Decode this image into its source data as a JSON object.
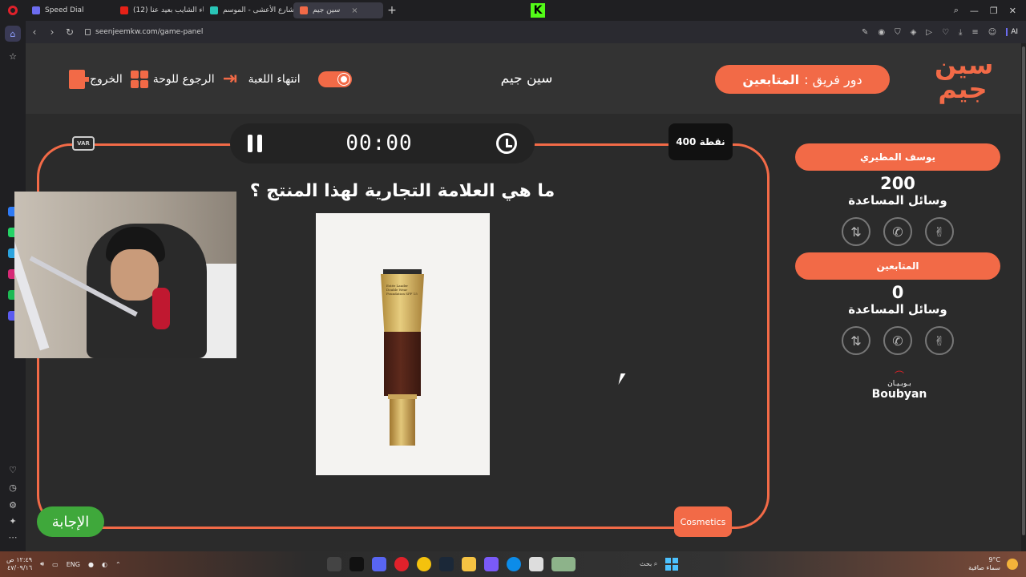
{
  "browser": {
    "tabs": [
      {
        "label": "Speed Dial",
        "fav_color": "#6c6cf0"
      },
      {
        "label": "(12) شيماء الشايب بعيد عنا...",
        "fav_color": "#e62117"
      },
      {
        "label": "شاهد شارع الأعشى - الموسم...",
        "fav_color": "#29c5b7"
      },
      {
        "label": "سين جيم",
        "fav_color": "#f26a47"
      }
    ],
    "new_tab": "+",
    "url": "seenjeemkw.com/game-panel",
    "ai_label": "AI"
  },
  "topbar": {
    "logo_text": "سين جيم",
    "turn_prefix": "دور فريق :",
    "turn_team": "المتابعين",
    "game_title": "سين جيم",
    "exit_label": "الخروج",
    "back_label": "الرجوع للوحة",
    "end_label": "انتهاء اللعبة"
  },
  "game": {
    "timer": "00:00",
    "points": "400 نقطة",
    "var_label": "VAR",
    "question": "ما هي العلامة التجارية لهذا المنتج ؟",
    "product_label": "Estée Lauder Double Wear Foundation SPF 15",
    "category": "Cosmetics",
    "answer_button": "الإجابة"
  },
  "teams": [
    {
      "name": "يوسف المطيري",
      "score": "200",
      "aids_label": "وسائل المساعدة",
      "aids": [
        "phone-swap-icon",
        "phone-icon",
        "peace-hand-icon"
      ]
    },
    {
      "name": "المتابعين",
      "score": "0",
      "aids_label": "وسائل المساعدة",
      "aids": [
        "phone-swap-icon",
        "phone-icon",
        "peace-hand-icon"
      ]
    }
  ],
  "sponsor": {
    "arabic": "بـوبـيـان",
    "english": "Boubyan"
  },
  "taskbar": {
    "time": "١٢:٤٩ ص",
    "date": "٤٧/٠٩/١٦",
    "lang": "ENG",
    "search": "بحث",
    "temp": "9°C",
    "weather": "سماء صافية"
  },
  "colors": {
    "accent": "#f26a47",
    "answer_green": "#3fa83b",
    "page_bg": "#2b2b2b"
  }
}
